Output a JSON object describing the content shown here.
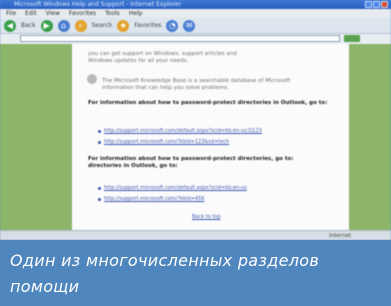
{
  "window": {
    "title": "Microsoft Windows Help and Support - Internet Explorer"
  },
  "menu": [
    "File",
    "Edit",
    "View",
    "Favorites",
    "Tools",
    "Help"
  ],
  "toolbar": {
    "back_label": "Back",
    "search_label": "Search",
    "favorites_label": "Favorites"
  },
  "page": {
    "intro_line1": "you can get support on Windows, support articles and",
    "intro_line2": "Windows updates for all your needs.",
    "tip_line1": "The Microsoft Knowledge Base is a searchable database of Microsoft",
    "tip_line2": "information that can help you solve problems.",
    "heading1": "For information about how to password-protect directories in Outlook, go to:",
    "links1": [
      "http://support.microsoft.com/default.aspx?scid=kb;en-us;Q123",
      "http://support.microsoft.com/?kbid=123&sd=tech"
    ],
    "heading2": "For information about how to password-protect directories, go to:",
    "heading2b": "directories in Outlook, go to:",
    "links2": [
      "http://support.microsoft.com/default.aspx?scid=kb;en-us",
      "http://support.microsoft.com/?kbid=456"
    ],
    "footer_link": "Back to top"
  },
  "status": {
    "zone": "Internet"
  },
  "caption": {
    "text": "Один из многочисленных разделов помощи"
  }
}
